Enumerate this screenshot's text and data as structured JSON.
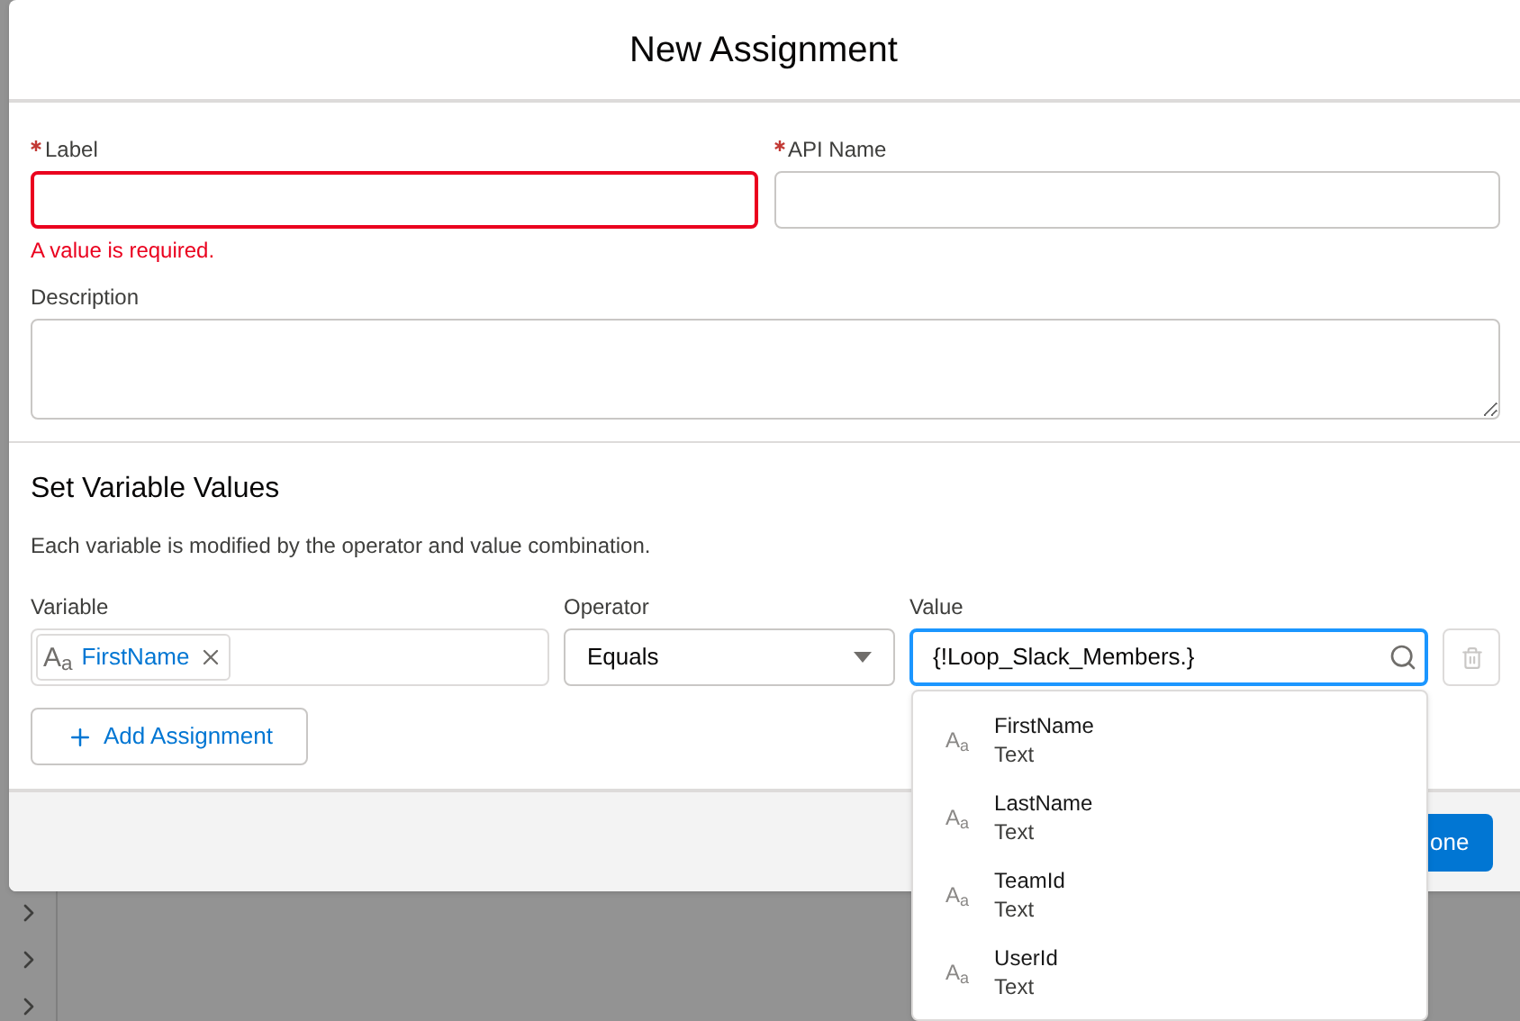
{
  "modal": {
    "title": "New Assignment"
  },
  "fields": [
    {
      "label": "Label",
      "required": true,
      "error": "A value is required."
    },
    {
      "label": "API Name",
      "required": true
    }
  ],
  "description": {
    "label": "Description"
  },
  "section": {
    "title": "Set Variable Values",
    "help": "Each variable is modified by the operator and value combination."
  },
  "assignment": {
    "variable_label": "Variable",
    "variable_pill": "FirstName",
    "variable_icon": "A$_{a}$",
    "operator_label": "Operator",
    "operator": "Equals",
    "value_label": "Value",
    "value": "{!Loop_Slack_Members.}"
  },
  "add_button": "Add Assignment",
  "dropdown": [
    {
      "icon": "A$_{a}$",
      "name": "FirstName",
      "type": "Text"
    },
    {
      "icon": "A$_{a}$",
      "name": "LastName",
      "type": "Text"
    },
    {
      "icon": "A$_{a}$",
      "name": "TeamId",
      "type": "Text"
    },
    {
      "icon": "A$_{a}$",
      "name": "UserId",
      "type": "Text"
    }
  ],
  "footer_button": "one"
}
